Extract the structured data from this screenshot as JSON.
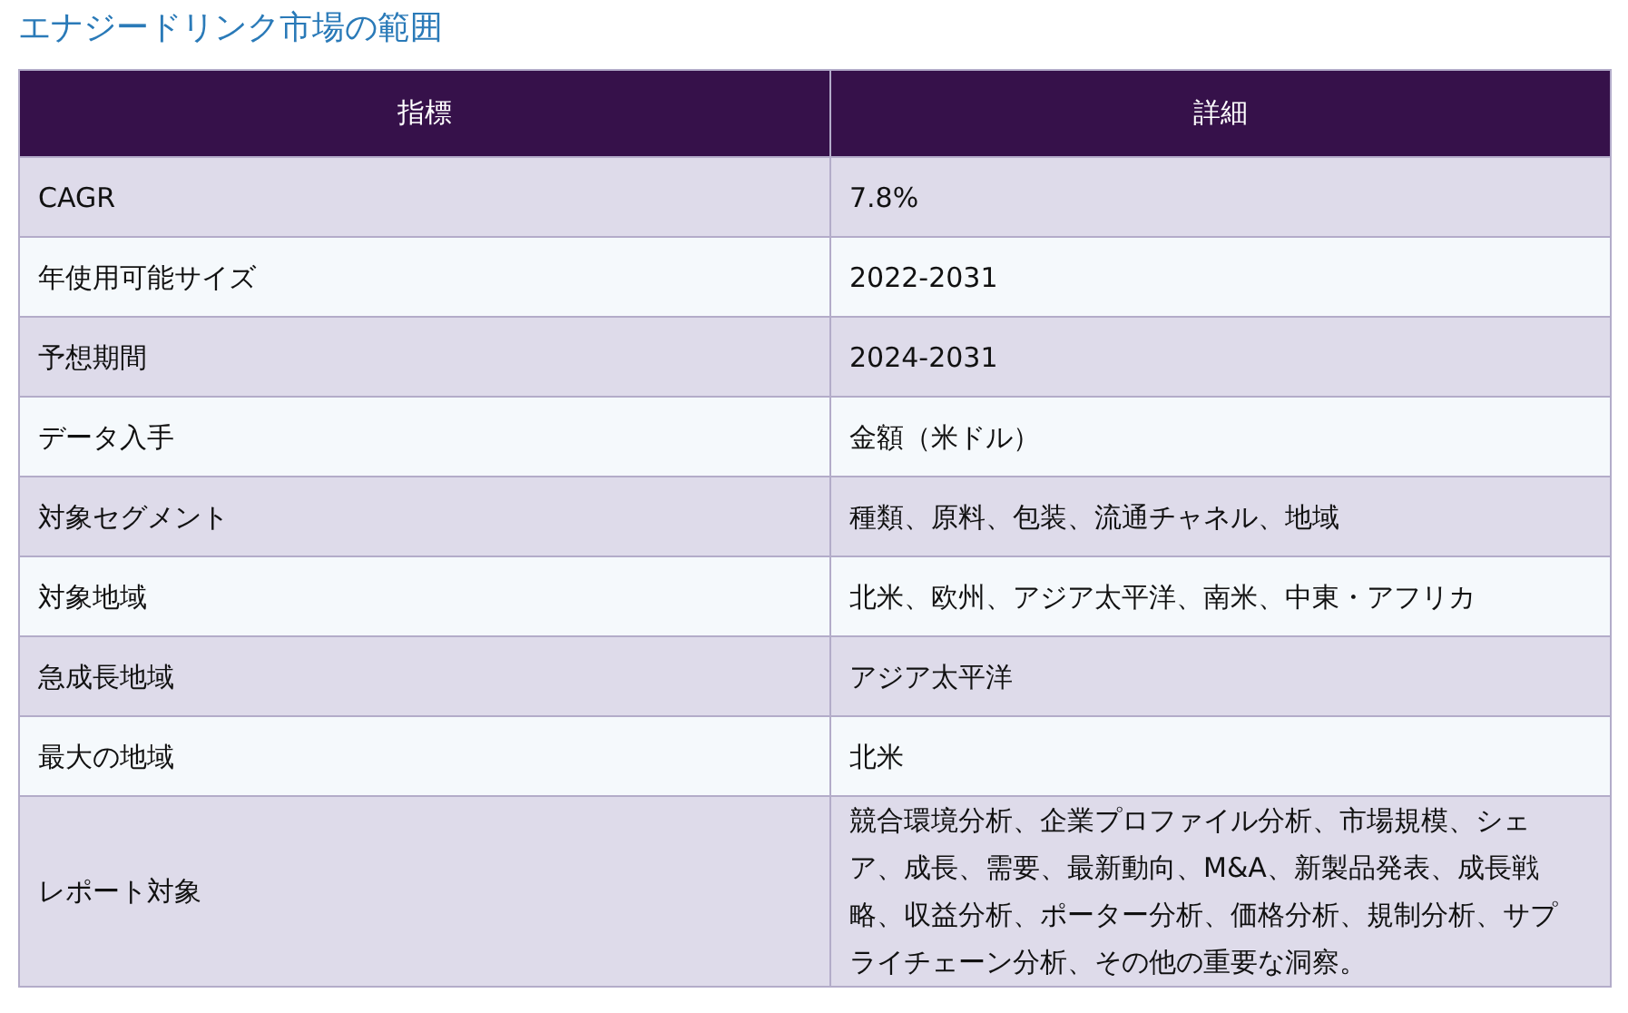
{
  "title": "エナジードリンク市場の範囲",
  "table": {
    "columns": [
      "指標",
      "詳細"
    ],
    "rows": [
      [
        "CAGR",
        "7.8%"
      ],
      [
        "年使用可能サイズ",
        "2022-2031"
      ],
      [
        "予想期間",
        "2024-2031"
      ],
      [
        "データ入手",
        "金額（米ドル）"
      ],
      [
        "対象セグメント",
        "種類、原料、包装、流通チャネル、地域"
      ],
      [
        "対象地域",
        "北米、欧州、アジア太平洋、南米、中東・アフリカ"
      ],
      [
        "急成長地域",
        "アジア太平洋"
      ],
      [
        "最大の地域",
        "北米"
      ],
      [
        "レポート対象",
        "競合環境分析、企業プロファイル分析、市場規模、シェア、成長、需要、最新動向、M&A、新製品発表、成長戦略、収益分析、ポーター分析、価格分析、規制分析、サプライチェーン分析、その他の重要な洞察。"
      ]
    ]
  }
}
